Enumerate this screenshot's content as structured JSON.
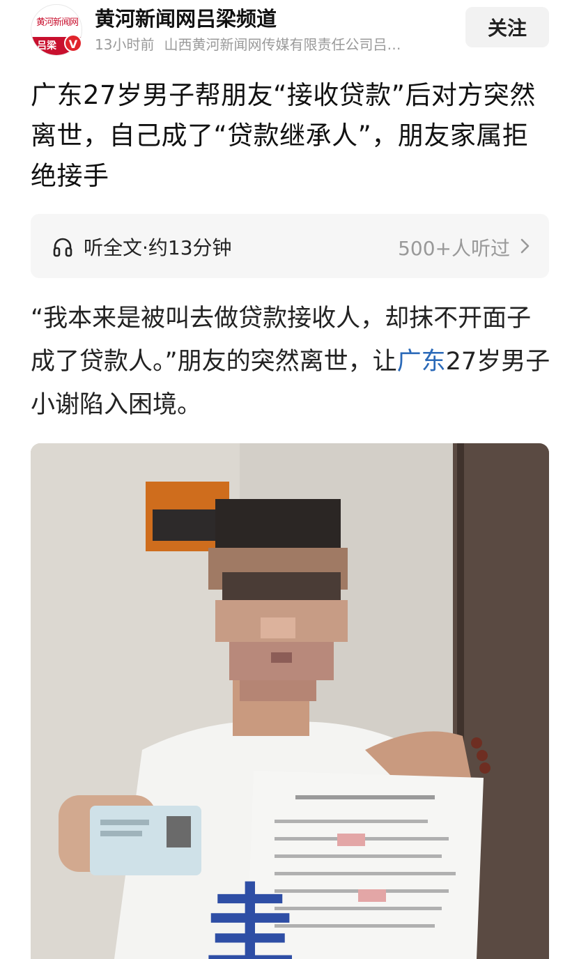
{
  "header": {
    "avatar_top_text": "黄河新闻网",
    "avatar_band_text": "吕梁",
    "verified_mark": "V",
    "source_name": "黄河新闻网吕梁频道",
    "time": "13小时前",
    "publisher": "山西黄河新闻网传媒有限责任公司吕…",
    "follow_label": "关注"
  },
  "article": {
    "title": "广东27岁男子帮朋友“接收贷款”后对方突然离世，自己成了“贷款继承人”，朋友家属拒绝接手",
    "listen": {
      "label": "听全文·约13分钟",
      "count": "500+人听过",
      "icon": "headphone-icon"
    },
    "body_before_link": "“我本来是被叫去做贷款接收人，却抹不开面子成了贷款人。”朋友的突然离世，让",
    "body_link": "广东",
    "body_after_link": "27岁男子小谢陷入困境。"
  },
  "colors": {
    "accent_red": "#c8102e",
    "link_blue": "#2a69b8",
    "muted_gray": "#9a9a9a"
  }
}
